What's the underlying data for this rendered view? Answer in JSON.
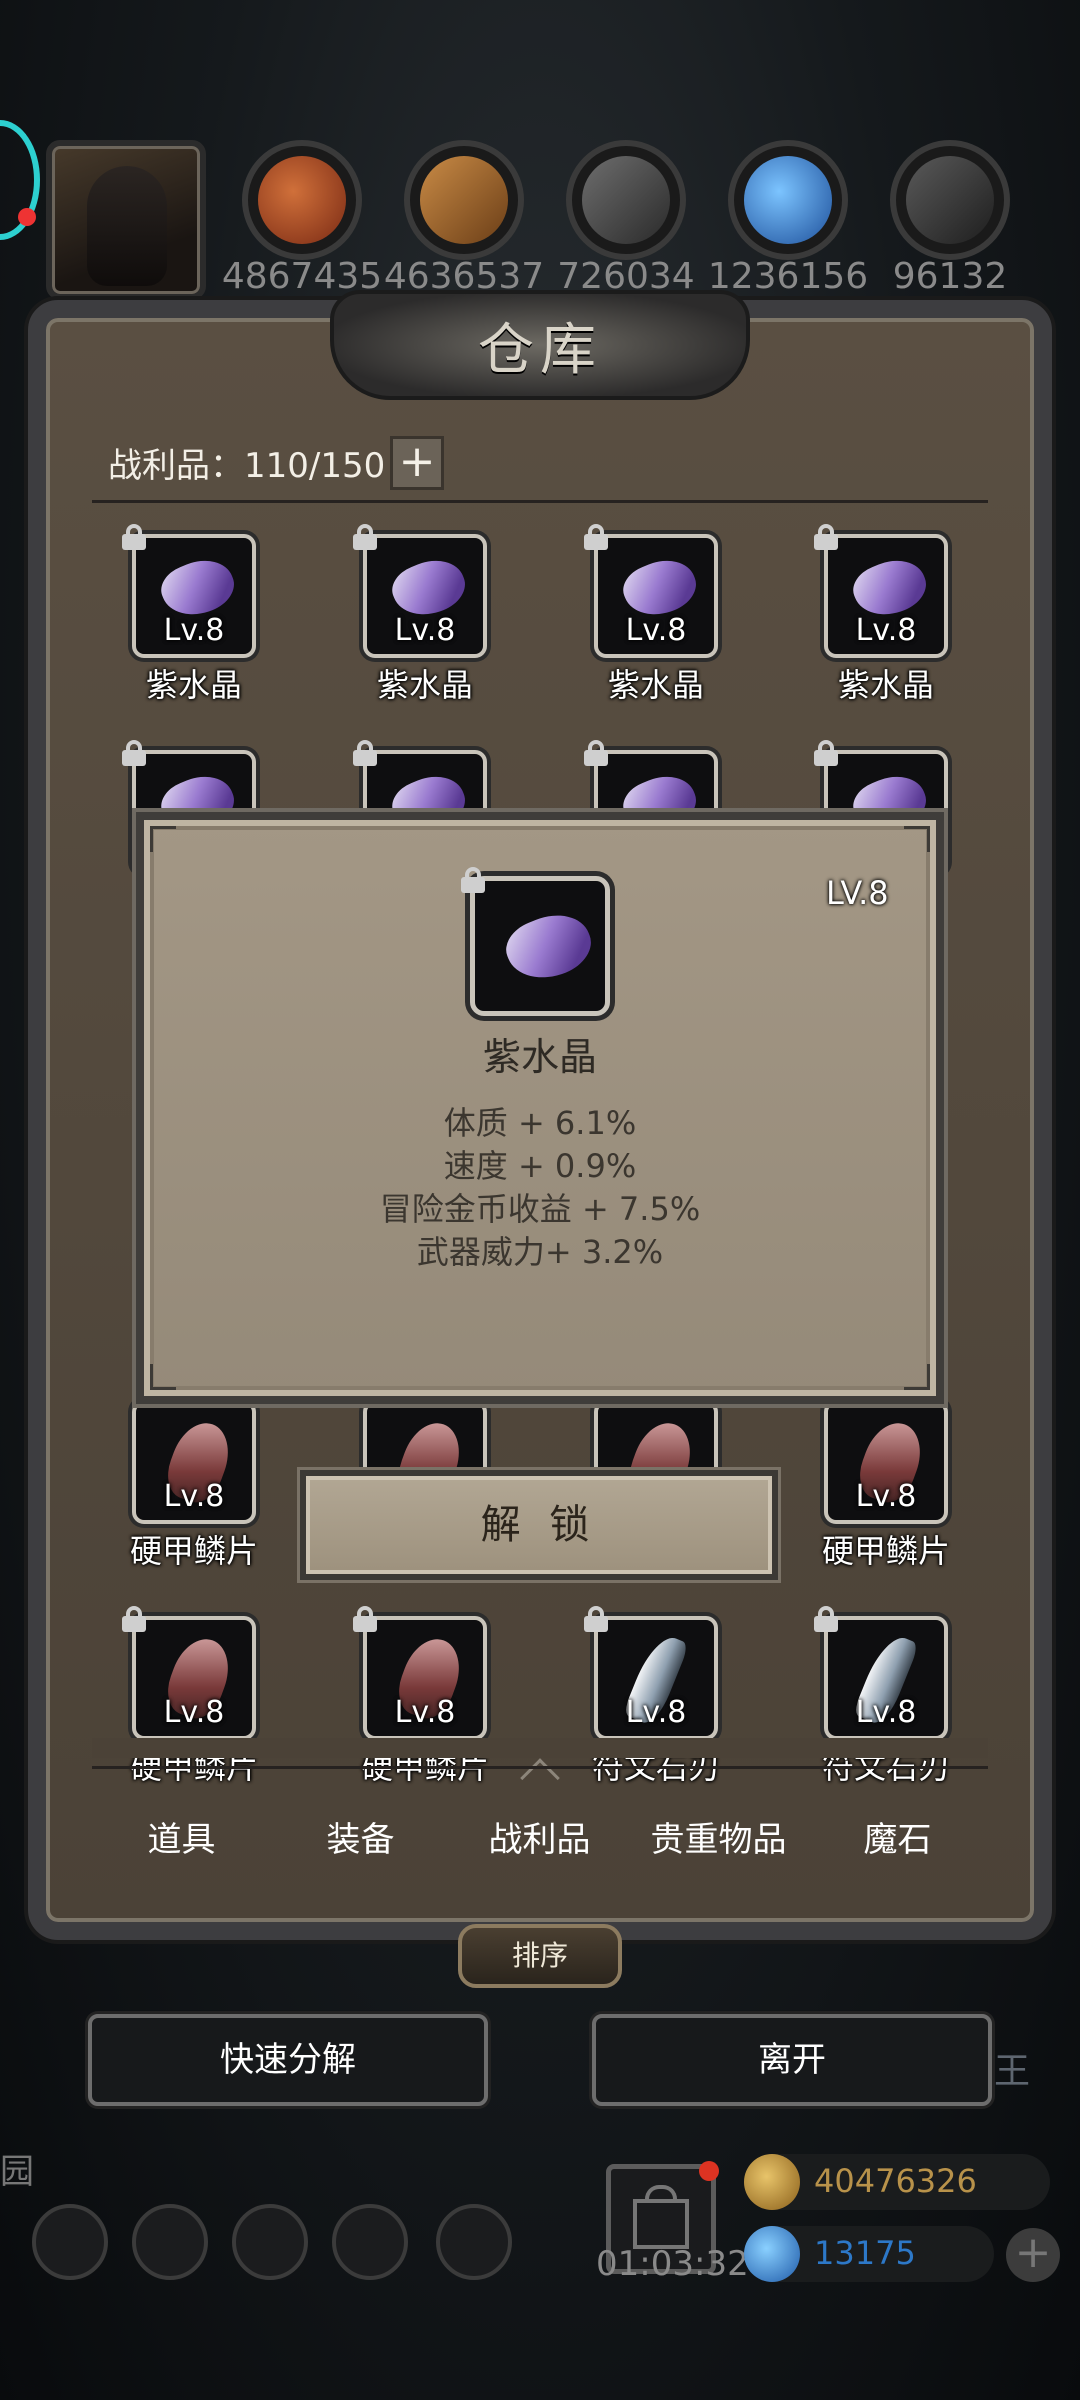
{
  "resources": [
    {
      "name": "meat",
      "count": "4867435",
      "color": "#b3502a"
    },
    {
      "name": "wood",
      "count": "4636537",
      "color": "#b97a3a"
    },
    {
      "name": "iron",
      "count": "726034",
      "color": "#555555"
    },
    {
      "name": "crystal",
      "count": "1236156",
      "color": "#3a8fe0"
    },
    {
      "name": "steel",
      "count": "96132",
      "color": "#444444"
    }
  ],
  "panel": {
    "title": "仓库",
    "capacity_label": "战利品：110/150",
    "plus": "+"
  },
  "items": [
    {
      "name": "紫水晶",
      "level": "Lv.8",
      "type": "gem"
    },
    {
      "name": "紫水晶",
      "level": "Lv.8",
      "type": "gem"
    },
    {
      "name": "紫水晶",
      "level": "Lv.8",
      "type": "gem"
    },
    {
      "name": "紫水晶",
      "level": "Lv.8",
      "type": "gem"
    },
    {
      "name": "硬甲鳞片",
      "level": "Lv.8",
      "type": "scale"
    },
    {
      "name": "硬甲鳞片",
      "level": "Lv.8",
      "type": "scale"
    },
    {
      "name": "符文石刃",
      "level": "Lv.8",
      "type": "blade"
    },
    {
      "name": "符文石刃",
      "level": "Lv.8",
      "type": "blade"
    }
  ],
  "popup": {
    "level": "LV.8",
    "name": "紫水晶",
    "stats": [
      "体质 + 6.1%",
      "速度 + 0.9%",
      "冒险金币收益 + 7.5%",
      "武器威力+ 3.2%"
    ],
    "unlock_label": "解 锁"
  },
  "tabs": [
    "道具",
    "装备",
    "战利品",
    "贵重物品",
    "魔石"
  ],
  "active_tab": "战利品",
  "sort_label": "排序",
  "actions": {
    "decompose": "快速分解",
    "leave": "离开"
  },
  "bottom": {
    "timer": "01:03:32",
    "gold": "40476326",
    "gems": "13175",
    "left_char": "园",
    "right_char": "王"
  },
  "colors": {
    "gold_text": "#b8924a",
    "gem_text": "#2d78c8",
    "panel_bg": "#4b4237",
    "popup_bg": "#9c917e"
  }
}
